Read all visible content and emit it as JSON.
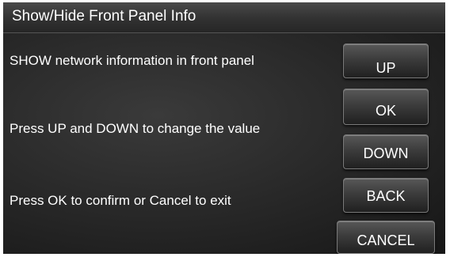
{
  "title_bar": {
    "title": "Show/Hide Front Panel Info"
  },
  "messages": [
    "SHOW network information in front panel",
    "Press UP and DOWN to change the value",
    "Press OK to confirm or Cancel to exit"
  ],
  "buttons": {
    "up": "UP",
    "ok": "OK",
    "down": "DOWN",
    "back": "BACK",
    "cancel": "CANCEL"
  }
}
